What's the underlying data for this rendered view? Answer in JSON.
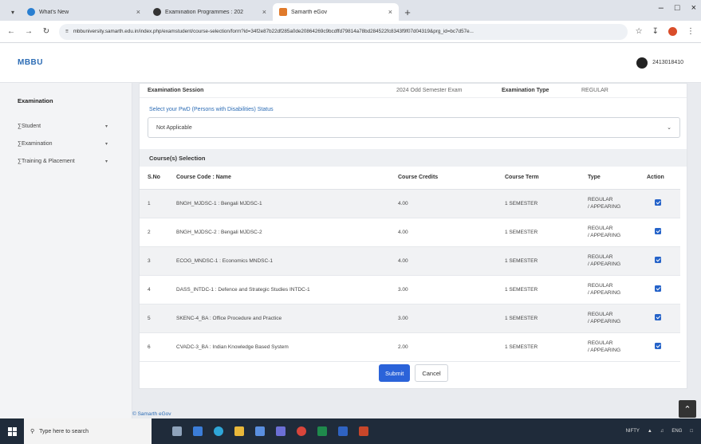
{
  "browser": {
    "tabs": [
      {
        "title": "What's New",
        "favicon_color": "#2a7fd1"
      },
      {
        "title": "Examination Programmes : 202",
        "favicon_color": "#333333"
      },
      {
        "title": "Samarth eGov",
        "favicon_color": "#e07a2b"
      }
    ],
    "url": "mbbuniversity.samarth.edu.in/index.php/examstudent/course-selection/form?id=34f2e87b22df285a0de20864269c9bcdffd79814a78bd284522fc8343f9f07d04319&prg_id=bc7d57e..."
  },
  "app": {
    "brand": "MBBU",
    "user_id": "2413018410"
  },
  "sidebar": {
    "title": "Examination",
    "items": [
      {
        "label": "Student"
      },
      {
        "label": "Examination"
      },
      {
        "label": "Training & Placement"
      }
    ]
  },
  "exam": {
    "session_label": "Examination Session",
    "session_value": "2024 Odd Semester Exam",
    "type_label": "Examination Type",
    "type_value": "REGULAR"
  },
  "pwd": {
    "label": "Select your PwD (Persons with Disabilities) Status",
    "selected": "Not Applicable"
  },
  "courses": {
    "section_title": "Course(s) Selection",
    "headers": [
      "S.No",
      "Course Code : Name",
      "Course Credits",
      "Course Term",
      "Type",
      "Action"
    ],
    "rows": [
      {
        "sno": "1",
        "name": "BNGH_MJDSC-1 : Bengali MJDSC-1",
        "credits": "4.00",
        "term": "1 SEMESTER",
        "type1": "REGULAR",
        "type2": "/ APPEARING"
      },
      {
        "sno": "2",
        "name": "BNGH_MJDSC-2 : Bengali MJDSC-2",
        "credits": "4.00",
        "term": "1 SEMESTER",
        "type1": "REGULAR",
        "type2": "/ APPEARING"
      },
      {
        "sno": "3",
        "name": "ECOG_MNDSC-1 : Economics MNDSC-1",
        "credits": "4.00",
        "term": "1 SEMESTER",
        "type1": "REGULAR",
        "type2": "/ APPEARING"
      },
      {
        "sno": "4",
        "name": "DASS_INTDC-1 : Defence and Strategic Studies INTDC-1",
        "credits": "3.00",
        "term": "1 SEMESTER",
        "type1": "REGULAR",
        "type2": "/ APPEARING"
      },
      {
        "sno": "5",
        "name": "SKENC-4_BA : Office Procedure and Practice",
        "credits": "3.00",
        "term": "1 SEMESTER",
        "type1": "REGULAR",
        "type2": "/ APPEARING"
      },
      {
        "sno": "6",
        "name": "CVADC-3_BA : Indian Knowledge Based System",
        "credits": "2.00",
        "term": "1 SEMESTER",
        "type1": "REGULAR",
        "type2": "/ APPEARING"
      }
    ]
  },
  "actions": {
    "submit": "Submit",
    "cancel": "Cancel"
  },
  "footer": {
    "text": "© Samarth eGov"
  },
  "taskbar": {
    "search_placeholder": "Type here to search",
    "tray_nifty": "NIFTY",
    "tray_lang": "ENG"
  }
}
